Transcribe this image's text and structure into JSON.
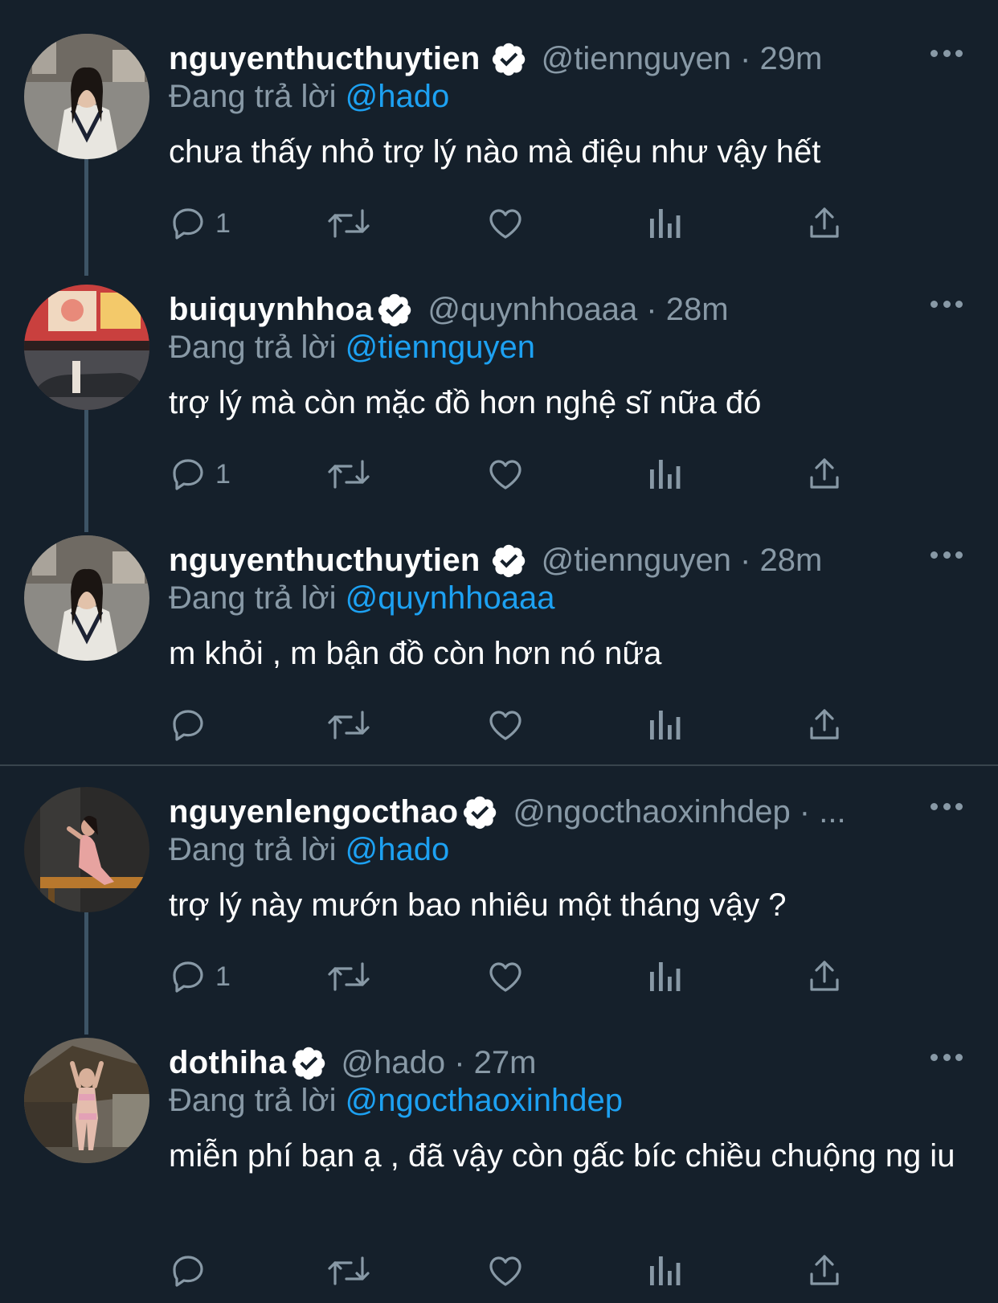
{
  "colors": {
    "background": "#15202b",
    "secondary_text": "#8899a6",
    "link": "#1da1f2",
    "thread_line": "#3d5466"
  },
  "reply_prefix": "Đang trả lời",
  "tweets": [
    {
      "name": "nguyenthucthuytien",
      "handle": "@tiennguyen · 29m",
      "reply_to": "@hado",
      "text": "chưa thấy nhỏ trợ lý nào mà điệu như vậy hết",
      "reply_count": "1"
    },
    {
      "name": "buiquynhhoa",
      "handle": "@quynhhoaaa · 28m",
      "reply_to": "@tiennguyen",
      "text": "trợ lý mà còn mặc đồ hơn nghệ sĩ nữa đó",
      "reply_count": "1"
    },
    {
      "name": "nguyenthucthuytien",
      "handle": "@tiennguyen · 28m",
      "reply_to": "@quynhhoaaa",
      "text": "m khỏi , m bận đồ còn hơn nó nữa",
      "reply_count": ""
    },
    {
      "name": "nguyenlengocthao",
      "handle": "@ngocthaoxinhdep · ...",
      "reply_to": "@hado",
      "text": "trợ lý này mướn bao nhiêu một tháng vậy ?",
      "reply_count": "1"
    },
    {
      "name": "dothiha",
      "handle": "@hado · 27m",
      "reply_to": "@ngocthaoxinhdep",
      "text": "miễn phí bạn ạ , đã vậy còn gấc bíc chiều chuộng ng iu",
      "reply_count": ""
    }
  ]
}
